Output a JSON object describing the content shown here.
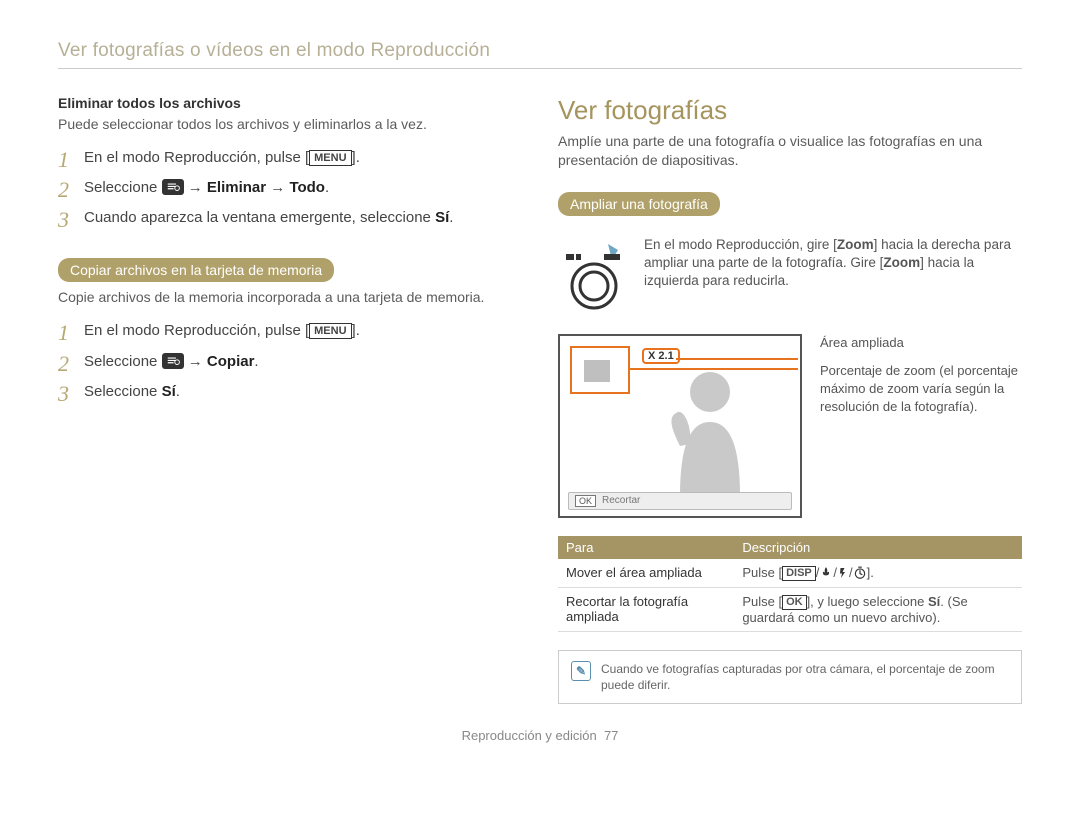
{
  "breadcrumb": "Ver fotografías o vídeos en el modo Reproducción",
  "left": {
    "delete_all": {
      "heading": "Eliminar todos los archivos",
      "desc": "Puede seleccionar todos los archivos y eliminarlos a la vez.",
      "step1_pre": "En el modo Reproducción, pulse [",
      "step1_btn": "MENU",
      "step1_post": "].",
      "step2_pre": "Seleccione ",
      "step2_arrow": " → ",
      "step2_b1": "Eliminar",
      "step2_b2": "Todo",
      "step2_post": ".",
      "step3_pre": "Cuando aparezca la ventana emergente, seleccione ",
      "step3_b": "Sí",
      "step3_post": "."
    },
    "copy": {
      "pill": "Copiar archivos en la tarjeta de memoria",
      "desc": "Copie archivos de la memoria incorporada a una tarjeta de memoria.",
      "step1_pre": "En el modo Reproducción, pulse [",
      "step1_btn": "MENU",
      "step1_post": "].",
      "step2_pre": "Seleccione ",
      "step2_arrow": "→ ",
      "step2_b": "Copiar",
      "step2_post": ".",
      "step3_pre": "Seleccione ",
      "step3_b": "Sí",
      "step3_post": "."
    }
  },
  "right": {
    "title": "Ver fotografías",
    "intro": "Amplíe una parte de una fotografía o visualice las fotografías en una presentación de diapositivas.",
    "enlarge_pill": "Ampliar una fotografía",
    "zoom_a": "En el modo Reproducción, gire [",
    "zoom_b": "Zoom",
    "zoom_c": "] hacia la derecha para ampliar una parte de la fotografía. Gire [",
    "zoom_d": "Zoom",
    "zoom_e": "] hacia la izquierda para reducirla.",
    "area_label": "Área ampliada",
    "ratio_label": "Porcentaje de zoom (el porcentaje máximo de zoom varía según la resolución de la fotografía).",
    "zoom_badge": "X 2.1",
    "trim_label": "Recortar",
    "table": {
      "h1": "Para",
      "h2": "Descripción",
      "r1c1": "Mover el área ampliada",
      "r1c2_pre": "Pulse [",
      "r1c2_disp": "DISP",
      "r1c2_post": "].",
      "r2c1": "Recortar la fotografía ampliada",
      "r2c2_a": "Pulse [",
      "r2c2_ok": "OK",
      "r2c2_b": "], y luego seleccione ",
      "r2c2_si": "Sí",
      "r2c2_c": ". (Se guardará como un nuevo archivo).",
      "ok_mini": "OK"
    },
    "note": "Cuando ve fotografías capturadas por otra cámara, el porcentaje de zoom puede diferir."
  },
  "footer_label": "Reproducción y edición",
  "footer_page": "77"
}
